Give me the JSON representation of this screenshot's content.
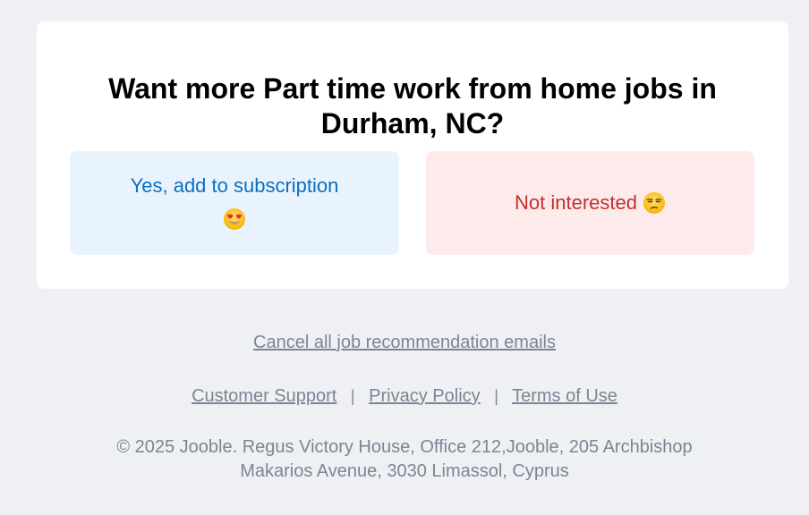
{
  "card": {
    "title_line1": "Want more Part time work from home jobs in",
    "title_line2": "Durham, NC?",
    "yes_button_label": "Yes, add to subscription",
    "no_button_label": "Not interested",
    "yes_emoji": "heart-eyes-emoji",
    "no_emoji": "unamused-face-emoji"
  },
  "footer": {
    "cancel_link": "Cancel all job recommendation emails",
    "links": [
      "Customer Support",
      "Privacy Policy",
      "Terms of Use"
    ],
    "separator": "|",
    "copyright_line1": "© 2025 Jooble. Regus Victory House, Office 212,Jooble, 205 Archbishop",
    "copyright_line2": "Makarios Avenue, 3030 Limassol, Cyprus"
  },
  "colors": {
    "page_bg": "#eef0f4",
    "card_bg": "#ffffff",
    "yes_bg": "#e8f3fe",
    "yes_text": "#0b6fbf",
    "no_bg": "#fdebec",
    "no_text": "#c0302c",
    "footer_text": "#7b8594"
  }
}
